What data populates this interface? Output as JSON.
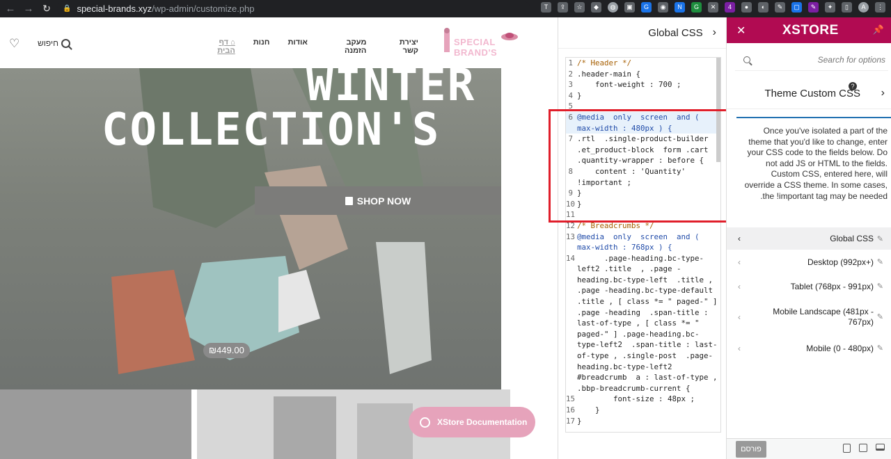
{
  "browser": {
    "url_host": "special-brands.xyz",
    "url_path": "/wp-admin/customize.php"
  },
  "site": {
    "search_label": "חיפוש",
    "menu": [
      "יצירת קשר",
      "מעקב הזמנה",
      "אודות",
      "חנות",
      "דף הבית"
    ],
    "logo_text": "SPECIAL BRAND'S",
    "hero_line1": "WINTER",
    "hero_line2": "COLLECTION'S",
    "shop_now": "SHOP NOW",
    "price": "₪449.00",
    "doc_button": "XStore Documentation"
  },
  "css_panel": {
    "title": "Global CSS",
    "lines": [
      {
        "n": "1",
        "text": "/* Header */"
      },
      {
        "n": "2",
        "text": ".header-main {"
      },
      {
        "n": "3",
        "text": "    font-weight : 700 ;"
      },
      {
        "n": "4",
        "text": "}"
      },
      {
        "n": "5",
        "text": ""
      },
      {
        "n": "6",
        "text": "@media  only  screen  and ( max-width : 480px ) {"
      },
      {
        "n": "7",
        "text": ".rtl  .single-product-builder .et_product-block  form .cart .quantity-wrapper : before {"
      },
      {
        "n": "8",
        "text": "    content : 'Quantity' !important ;"
      },
      {
        "n": "9",
        "text": "}"
      },
      {
        "n": "10",
        "text": "}"
      },
      {
        "n": "11",
        "text": ""
      },
      {
        "n": "12",
        "text": "/* Breadcrumbs */"
      },
      {
        "n": "13",
        "text": "@media  only  screen  and ( max-width : 768px ) {"
      },
      {
        "n": "14",
        "text": "      .page-heading.bc-type-left2 .title  , .page - heading.bc-type-left  .title , .page -heading.bc-type-default .title , [ class *= \" paged-\" ] .page -heading  .span-title : last-of-type , [ class *= \" paged-\" ] .page-heading.bc-type-left2  .span-title : last-of-type , .single-post  .page-heading.bc-type-left2 #breadcrumb  a : last-of-type , .bbp-breadcrumb-current {"
      },
      {
        "n": "15",
        "text": "        font-size : 48px ;"
      },
      {
        "n": "16",
        "text": "    }"
      },
      {
        "n": "17",
        "text": "}"
      }
    ]
  },
  "xstore": {
    "brand": "XSTORE",
    "search_placeholder": "Search for options",
    "section_title": "Theme Custom CSS",
    "note": "Once you've isolated a part of the theme that you'd like to change, enter your CSS code to the fields below. Do not add JS or HTML to the fields. Custom CSS, entered here, will override a CSS theme. In some cases, the !important tag may be needed.",
    "items": [
      {
        "label": "Global CSS",
        "active": true
      },
      {
        "label": "Desktop (992px+)",
        "active": false
      },
      {
        "label": "Tablet (768px - 991px)",
        "active": false
      },
      {
        "label": "Mobile Landscape (481px - 767px)",
        "active": false
      },
      {
        "label": "Mobile (0 - 480px)",
        "active": false
      }
    ],
    "publish": "פורסם"
  }
}
